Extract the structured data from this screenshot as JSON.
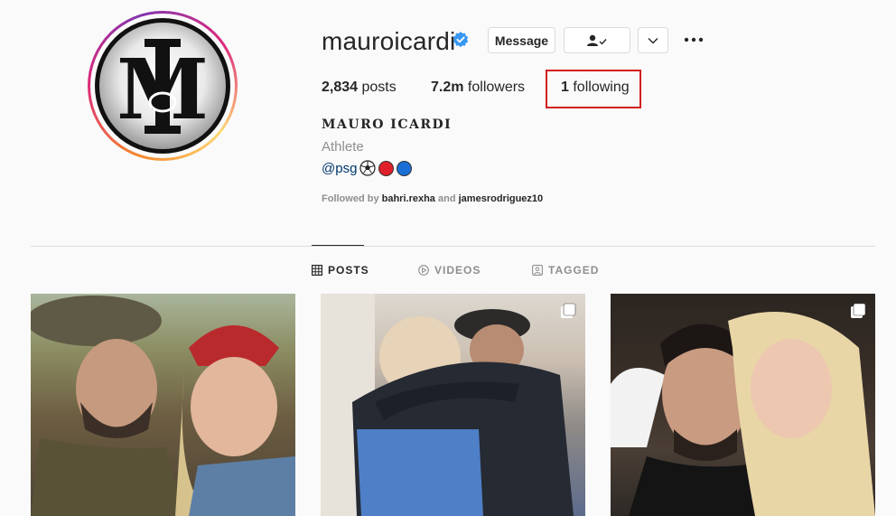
{
  "profile": {
    "username": "mauroicardi",
    "verified": true,
    "avatar_logo_letters": "MI",
    "full_name": "MAURO ICARDI",
    "category": "Athlete",
    "bio_handle": "@psg",
    "bio_emojis": [
      "soccer-ball-icon",
      "red-circle-icon",
      "blue-circle-icon"
    ]
  },
  "actions": {
    "message_label": "Message",
    "following_icon": "person-check-icon",
    "dropdown_icon": "chevron-down-icon",
    "more_icon": "more-options-icon"
  },
  "stats": {
    "posts_count": "2,834",
    "posts_label": "posts",
    "followers_count": "7.2m",
    "followers_label": "followers",
    "following_count": "1",
    "following_label": "following"
  },
  "followed_by": {
    "prefix": "Followed by",
    "user1": "bahri.rexha",
    "conjunction": "and",
    "user2": "jamesrodriguez10"
  },
  "tabs": [
    {
      "label": "POSTS",
      "icon": "grid-icon",
      "active": true
    },
    {
      "label": "VIDEOS",
      "icon": "play-icon",
      "active": false
    },
    {
      "label": "TAGGED",
      "icon": "tagged-icon",
      "active": false
    }
  ],
  "colors": {
    "highlight": "#d41e1e",
    "verified": "#3897f0",
    "link": "#00376b",
    "red_dot": "#e0202a",
    "blue_dot": "#1a6fd6"
  }
}
